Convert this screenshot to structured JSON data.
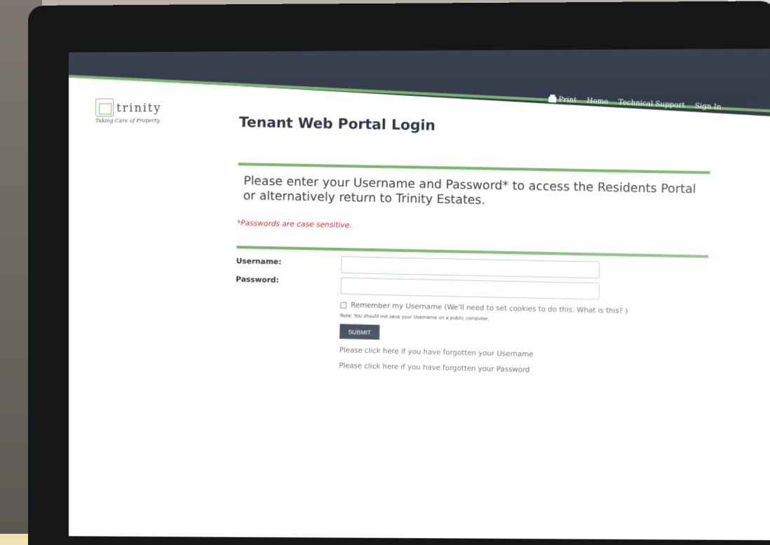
{
  "nav": {
    "items": [
      "Print",
      "Home",
      "Technical Support",
      "Sign In"
    ]
  },
  "logo": {
    "name": "trinity",
    "tagline": "Taking Care of Property"
  },
  "page": {
    "title": "Tenant Web Portal Login",
    "intro": "Please enter your Username and Password* to access the Residents Portal or alternatively return to Trinity Estates.",
    "case_note": "*Passwords are case sensitive."
  },
  "form": {
    "username_label": "Username:",
    "password_label": "Password:",
    "username_value": "",
    "password_value": "",
    "remember_label": "Remember my Username (We'll need to set cookies to do this.  What is this? )",
    "remember_checked": false,
    "public_note": "Note: You should not save your Username on a public computer.",
    "submit_label": "SUBMIT",
    "forgot_username": "Please click here if you have forgotten your Username",
    "forgot_password": "Please click here if you have forgotten your Password"
  },
  "colors": {
    "accent_green": "#7ab56d",
    "navbar": "#3a4150",
    "submit_bg": "#2d3648",
    "warning_red": "#d0282e"
  }
}
